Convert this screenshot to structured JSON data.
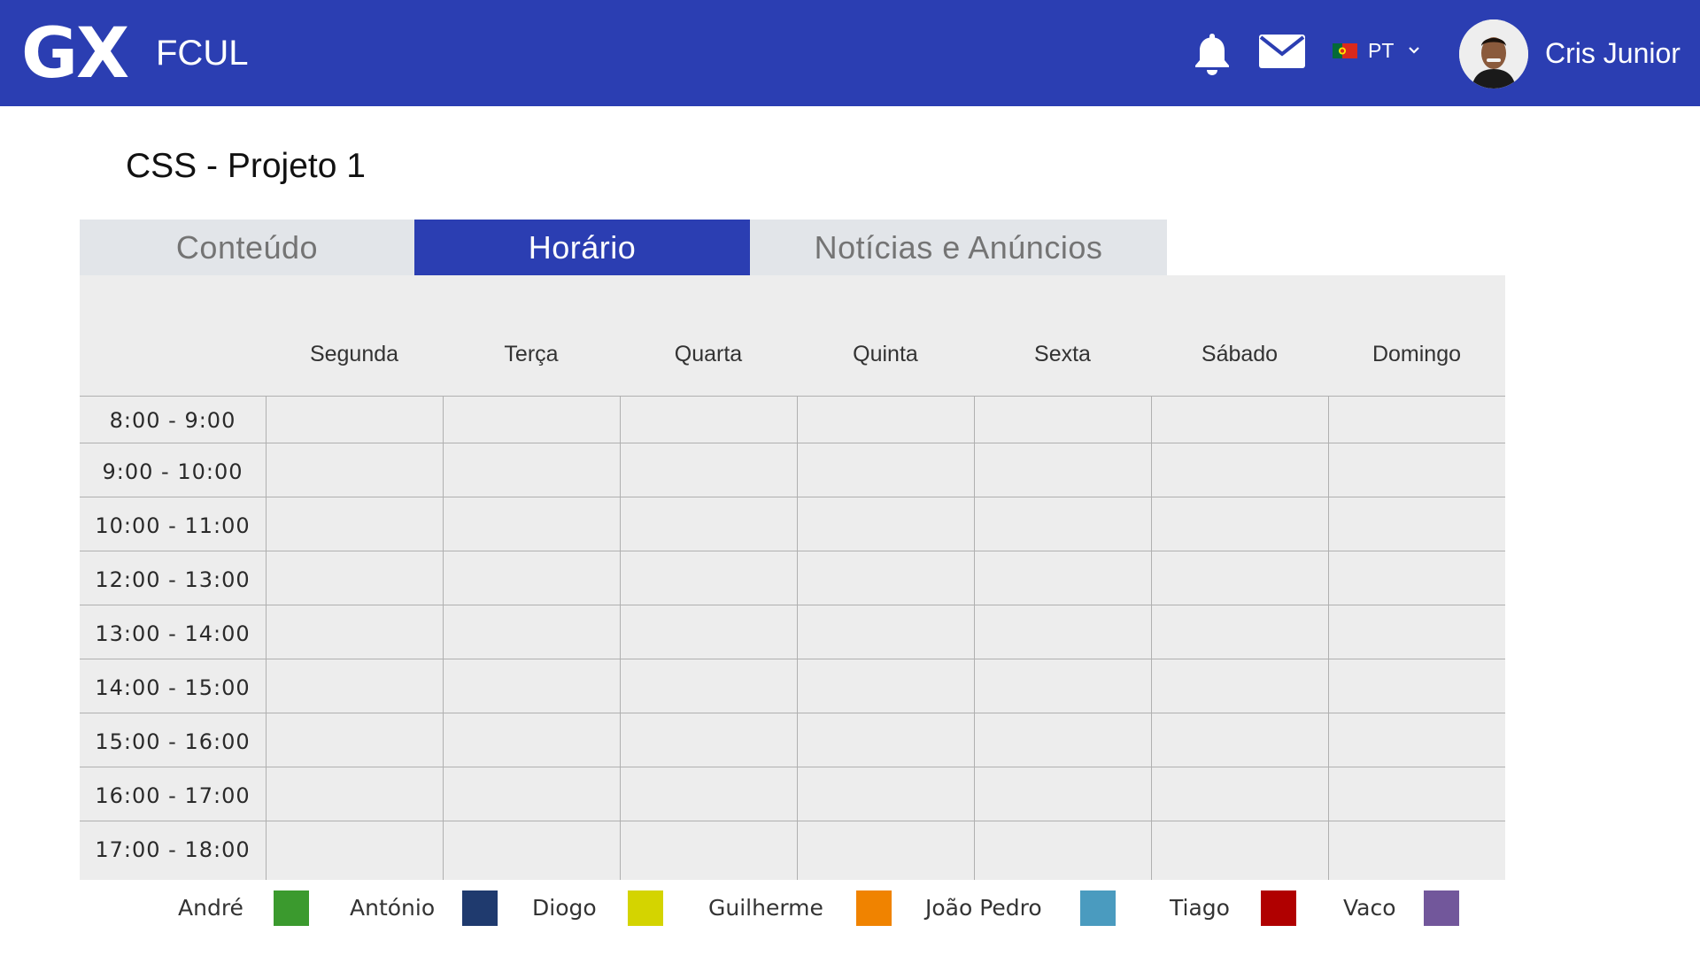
{
  "header": {
    "logo": "GX",
    "app_name": "FCUL",
    "language": "PT",
    "username": "Cris Junior"
  },
  "page": {
    "title": "CSS - Projeto 1"
  },
  "tabs": [
    {
      "label": "Conteúdo",
      "active": false
    },
    {
      "label": "Horário",
      "active": true
    },
    {
      "label": "Notícias e Anúncios",
      "active": false
    }
  ],
  "schedule": {
    "days": [
      "Segunda",
      "Terça",
      "Quarta",
      "Quinta",
      "Sexta",
      "Sábado",
      "Domingo"
    ],
    "times": [
      "8:00 - 9:00",
      "9:00 - 10:00",
      "10:00 - 11:00",
      "12:00 - 13:00",
      "13:00 - 14:00",
      "14:00 - 15:00",
      "15:00 - 16:00",
      "16:00 - 17:00",
      "17:00 - 18:00"
    ]
  },
  "legend": [
    {
      "name": "André",
      "color": "#3b9a2e"
    },
    {
      "name": "António",
      "color": "#1f3a6e"
    },
    {
      "name": "Diogo",
      "color": "#d4d400"
    },
    {
      "name": "Guilherme",
      "color": "#f08300"
    },
    {
      "name": "João Pedro",
      "color": "#4a9bbf"
    },
    {
      "name": "Tiago",
      "color": "#b00000"
    },
    {
      "name": "Vaco",
      "color": "#72579b"
    }
  ],
  "colors": {
    "brand": "#2b3eb2",
    "panel": "#ededed",
    "tab_inactive": "#e2e5e9"
  }
}
